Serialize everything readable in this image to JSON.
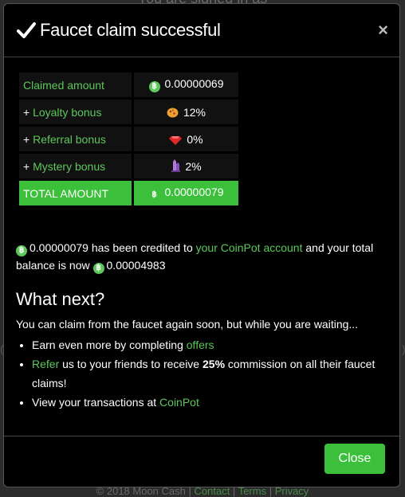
{
  "backdrop": {
    "top_text": "You are signed in as",
    "footer_prefix": "© 2018 Moon Cash |",
    "footer_links": [
      "Contact",
      "Terms",
      "Privacy"
    ]
  },
  "modal": {
    "title": "Faucet claim successful",
    "close_icon": "×",
    "rows": [
      {
        "label_prefix": "",
        "label": "Claimed amount",
        "icon": "bitcoin-icon",
        "value": "0.00000069"
      },
      {
        "label_prefix": "+ ",
        "label": "Loyalty bonus",
        "icon": "cookie-icon",
        "value": "12%"
      },
      {
        "label_prefix": "+ ",
        "label": "Referral bonus",
        "icon": "gem-icon",
        "value": "0%"
      },
      {
        "label_prefix": "+ ",
        "label": "Mystery bonus",
        "icon": "crystal-icon",
        "value": "2%"
      }
    ],
    "total": {
      "label": "TOTAL AMOUNT",
      "icon": "bitcoin-icon",
      "value": "0.00000079"
    },
    "credited": {
      "amount": "0.00000079",
      "text1": " has been credited to ",
      "link": "your CoinPot account",
      "text2": " and your total balance is now ",
      "balance": "0.00004983"
    },
    "what_next": "What next?",
    "claim_text": "You can claim from the faucet again soon, but while you are waiting...",
    "bullets": {
      "b1_text": "Earn even more by completing ",
      "b1_link": "offers",
      "b2_link": "Refer",
      "b2_text1": " us to your friends to receive ",
      "b2_bold": "25%",
      "b2_text2": " commission on all their faucet claims!",
      "b3_text": "View your transactions at ",
      "b3_link": "CoinPot"
    },
    "close_button": "Close"
  },
  "colors": {
    "accent": "#3cc03c",
    "link": "#5cc85c",
    "background": "#000000"
  }
}
